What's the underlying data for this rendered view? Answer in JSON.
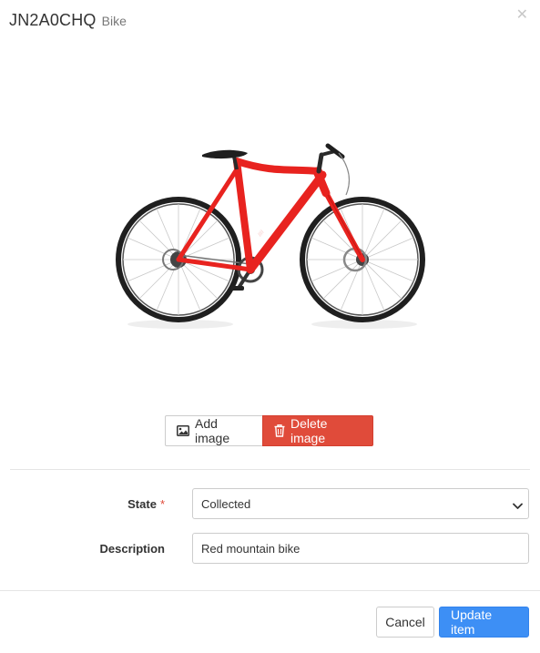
{
  "header": {
    "item_code": "JN2A0CHQ",
    "item_type": "Bike",
    "close_icon": "close-icon"
  },
  "image": {
    "subject": "red-bicycle-image",
    "colors": {
      "frame": "#e8231f",
      "tire": "#222222"
    }
  },
  "image_actions": {
    "add_label": "Add image",
    "add_icon": "image-icon",
    "delete_label": "Delete image",
    "delete_icon": "trash-icon"
  },
  "form": {
    "state": {
      "label": "State",
      "required_mark": "*",
      "value": "Collected"
    },
    "description": {
      "label": "Description",
      "value": "Red mountain bike"
    }
  },
  "footer": {
    "cancel_label": "Cancel",
    "update_label": "Update item"
  },
  "colors": {
    "danger": "#e04b3a",
    "primary": "#3d8ff5"
  }
}
